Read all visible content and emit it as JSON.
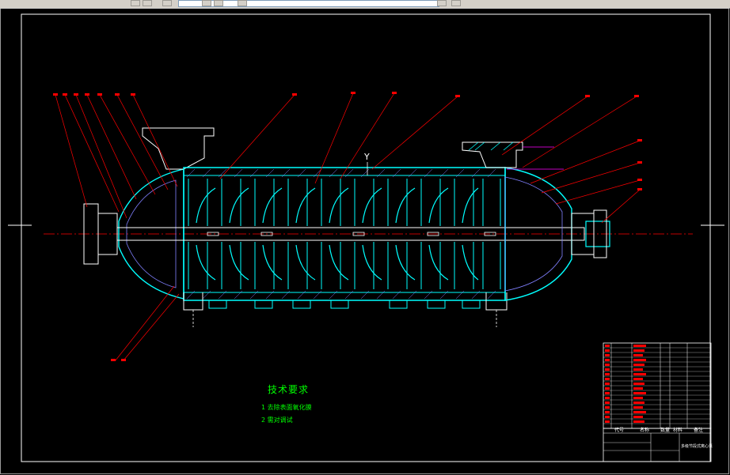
{
  "window": {
    "toolbar": {
      "layer_field": "",
      "icons": [
        "layers-icon",
        "layer-state-icon",
        "dropdown-icon",
        "color-icon",
        "linetype-icon",
        "lineweight-icon",
        "print-icon",
        "properties-icon"
      ]
    }
  },
  "drawing": {
    "background_color": "#000000",
    "frame_color": "#ffffff",
    "pump_colors": {
      "section": "#00ffff",
      "hatch": "#8080ff",
      "center_line": "#ff0000",
      "leaders": "#ff0000",
      "outline": "#ffffff",
      "accent": "#ff00ff"
    },
    "view_marker": "Y",
    "tech_requirements": {
      "title": "技术要求",
      "items": [
        "1 去除表面氧化膜",
        "2 需对调试"
      ],
      "text_color": "#00ff00"
    },
    "title_block": {
      "col_codes": "代号",
      "col_name": "名称",
      "col_qty": "数量",
      "col_material": "材料",
      "col_note": "备注",
      "drawing_name": "多级节段式离心泵",
      "rows_color": "#ff0000"
    }
  }
}
